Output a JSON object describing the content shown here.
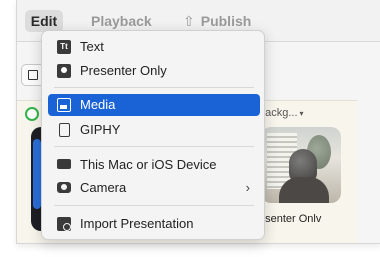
{
  "toolbar": {
    "edit_label": "Edit",
    "playback_label": "Playback",
    "publish_label": "Publish",
    "publish_icon": "share-up-icon"
  },
  "panel": {
    "background_label": "backg...",
    "presenter_label": "esenter Onlv"
  },
  "menu": {
    "items": [
      {
        "label": "Text",
        "icon": "text-icon"
      },
      {
        "label": "Presenter Only",
        "icon": "presenter-icon"
      },
      {
        "label": "Media",
        "icon": "media-icon",
        "selected": true
      },
      {
        "label": "GIPHY",
        "icon": "giphy-icon"
      },
      {
        "label": "This Mac or iOS Device",
        "icon": "device-icon"
      },
      {
        "label": "Camera",
        "icon": "camera-icon",
        "submenu": true
      },
      {
        "label": "Import Presentation",
        "icon": "import-icon"
      }
    ]
  },
  "colors": {
    "selection": "#1a63d6",
    "status_green": "#33b24a"
  }
}
